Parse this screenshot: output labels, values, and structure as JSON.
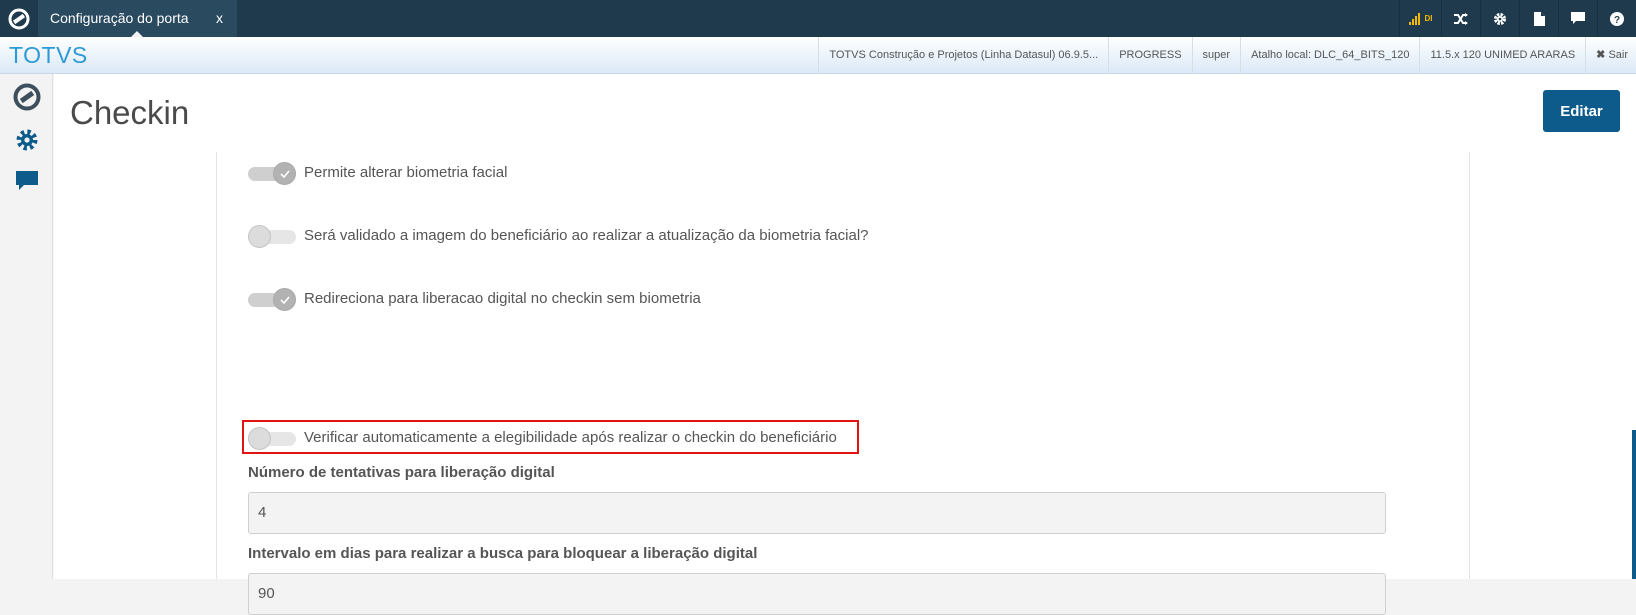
{
  "topbar": {
    "tab_title": "Configuração do porta",
    "tab_close": "x",
    "signal_label": "DI",
    "icons": [
      "shuffle-icon",
      "gear-icon",
      "document-icon",
      "chat-icon",
      "help-icon"
    ]
  },
  "header": {
    "brand": "TOTVS",
    "info": [
      "TOTVS Construção e Projetos (Linha Datasul) 06.9.5...",
      "PROGRESS",
      "super",
      "Atalho local: DLC_64_BITS_120",
      "11.5.x 120 UNIMED ARARAS"
    ],
    "exit_label": "Sair"
  },
  "sidebar": {
    "icons": [
      "totvs-logo-icon",
      "gear-icon",
      "chat-icon"
    ]
  },
  "main": {
    "title": "Checkin",
    "edit_label": "Editar",
    "toggles": [
      {
        "label": "Permite alterar biometria facial",
        "on": true
      },
      {
        "label": "Será validado a imagem do beneficiário ao realizar a atualização da biometria facial?",
        "on": false
      },
      {
        "label": "Redireciona para liberacao digital no checkin sem biometria",
        "on": true
      },
      {
        "label": "Verificar automaticamente a elegibilidade após realizar o checkin do beneficiário",
        "on": false
      }
    ],
    "fields": [
      {
        "label": "Número de tentativas para liberação digital",
        "value": "4"
      },
      {
        "label": "Intervalo em dias para realizar a busca para bloquear a liberação digital",
        "value": "90"
      }
    ]
  },
  "colors": {
    "topbar": "#1f3a4d",
    "brand": "#2d9ad6",
    "primary_button": "#0c5b8b",
    "highlight_border": "#e31313"
  }
}
